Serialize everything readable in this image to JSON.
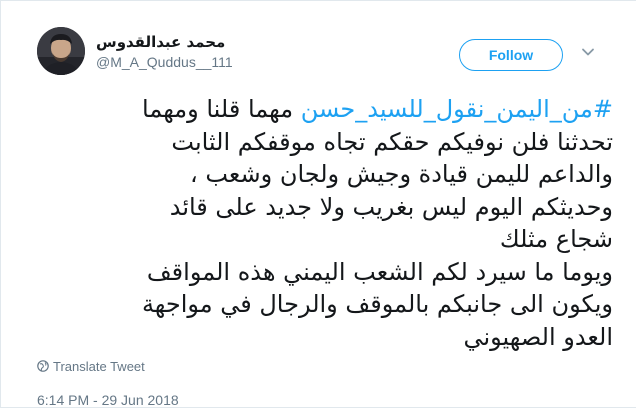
{
  "user": {
    "display_name": "محمد عبدالقدوس",
    "handle": "@M_A_Quddus__111"
  },
  "actions": {
    "follow_label": "Follow"
  },
  "tweet": {
    "hashtag": "#من_اليمن_نقول_للسيد_حسن",
    "line1_rest": " مهما قلنا ومهما",
    "lines": [
      "تحدثنا فلن نوفيكم حقكم تجاه موقفكم الثابت",
      "والداعم لليمن قيادة وجيش ولجان وشعب ،",
      "وحديثكم اليوم ليس بغريب ولا جديد على قائد",
      "شجاع مثلك",
      "ويوما ما سيرد لكم الشعب اليمني هذه المواقف",
      "ويكون الى جانبكم بالموقف والرجال في مواجهة",
      "العدو الصهيوني"
    ]
  },
  "translate_label": "Translate Tweet",
  "timestamp": "6:14 PM - 29 Jun 2018",
  "colors": {
    "accent": "#1da1f2",
    "text": "#14171a",
    "secondary": "#657786",
    "border": "#e1e8ed"
  },
  "icons": {
    "avatar": "profile-photo",
    "chevron": "chevron-down-icon",
    "globe": "globe-icon"
  }
}
